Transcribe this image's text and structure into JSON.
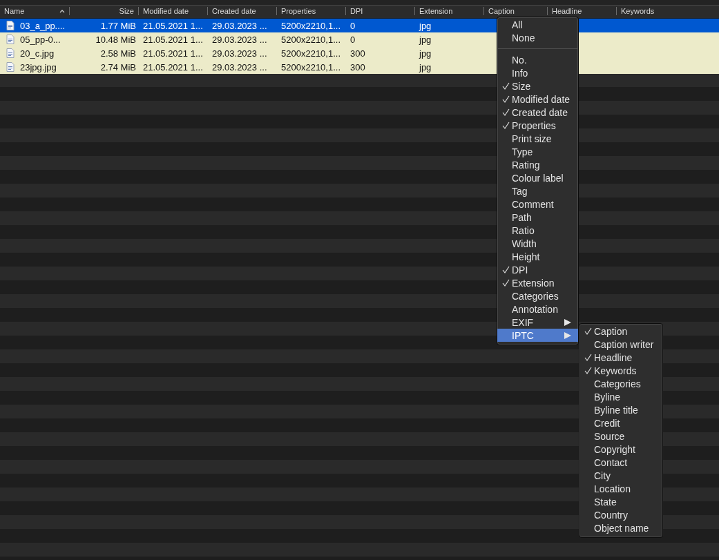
{
  "table": {
    "columns": [
      {
        "label": "Name",
        "sorted": true
      },
      {
        "label": "Size",
        "sorted": false
      },
      {
        "label": "Modified date",
        "sorted": false
      },
      {
        "label": "Created date",
        "sorted": false
      },
      {
        "label": "Properties",
        "sorted": false
      },
      {
        "label": "DPI",
        "sorted": false
      },
      {
        "label": "Extension",
        "sorted": false
      },
      {
        "label": "Caption",
        "sorted": false
      },
      {
        "label": "Headline",
        "sorted": false
      },
      {
        "label": "Keywords",
        "sorted": false
      }
    ],
    "rows": [
      {
        "selected": true,
        "cells": [
          "03_a_pp....",
          "1.77 MiB",
          "21.05.2021 1...",
          "29.03.2023 ...",
          "5200x2210,1...",
          "0",
          "jpg"
        ]
      },
      {
        "selected": false,
        "cells": [
          "05_pp-0...",
          "10.48 MiB",
          "21.05.2021 1...",
          "29.03.2023 ...",
          "5200x2210,1...",
          "0",
          "jpg"
        ]
      },
      {
        "selected": false,
        "cells": [
          "20_c.jpg",
          "2.58 MiB",
          "21.05.2021 1...",
          "29.03.2023 ...",
          "5200x2210,1...",
          "300",
          "jpg"
        ]
      },
      {
        "selected": false,
        "cells": [
          "23jpg.jpg",
          "2.74 MiB",
          "21.05.2021 1...",
          "29.03.2023 ...",
          "5200x2210,1...",
          "300",
          "jpg"
        ]
      }
    ]
  },
  "context_menu": {
    "items": [
      {
        "kind": "item",
        "label": "All",
        "checked": false
      },
      {
        "kind": "item",
        "label": "None",
        "checked": false
      },
      {
        "kind": "separator"
      },
      {
        "kind": "item",
        "label": "No.",
        "checked": false
      },
      {
        "kind": "item",
        "label": "Info",
        "checked": false
      },
      {
        "kind": "item",
        "label": "Size",
        "checked": true
      },
      {
        "kind": "item",
        "label": "Modified date",
        "checked": true
      },
      {
        "kind": "item",
        "label": "Created date",
        "checked": true
      },
      {
        "kind": "item",
        "label": "Properties",
        "checked": true
      },
      {
        "kind": "item",
        "label": "Print size",
        "checked": false
      },
      {
        "kind": "item",
        "label": "Type",
        "checked": false
      },
      {
        "kind": "item",
        "label": "Rating",
        "checked": false
      },
      {
        "kind": "item",
        "label": "Colour label",
        "checked": false
      },
      {
        "kind": "item",
        "label": "Tag",
        "checked": false
      },
      {
        "kind": "item",
        "label": "Comment",
        "checked": false
      },
      {
        "kind": "item",
        "label": "Path",
        "checked": false
      },
      {
        "kind": "item",
        "label": "Ratio",
        "checked": false
      },
      {
        "kind": "item",
        "label": "Width",
        "checked": false
      },
      {
        "kind": "item",
        "label": "Height",
        "checked": false
      },
      {
        "kind": "item",
        "label": "DPI",
        "checked": true
      },
      {
        "kind": "item",
        "label": "Extension",
        "checked": true
      },
      {
        "kind": "item",
        "label": "Categories",
        "checked": false
      },
      {
        "kind": "item",
        "label": "Annotation",
        "checked": false
      },
      {
        "kind": "submenu",
        "label": "EXIF",
        "selected": false
      },
      {
        "kind": "submenu",
        "label": "IPTC",
        "selected": true
      }
    ]
  },
  "submenu": {
    "items": [
      {
        "label": "Caption",
        "checked": true
      },
      {
        "label": "Caption writer",
        "checked": false
      },
      {
        "label": "Headline",
        "checked": true
      },
      {
        "label": "Keywords",
        "checked": true
      },
      {
        "label": "Categories",
        "checked": false
      },
      {
        "label": "Byline",
        "checked": false
      },
      {
        "label": "Byline title",
        "checked": false
      },
      {
        "label": "Credit",
        "checked": false
      },
      {
        "label": "Source",
        "checked": false
      },
      {
        "label": "Copyright",
        "checked": false
      },
      {
        "label": "Contact",
        "checked": false
      },
      {
        "label": "City",
        "checked": false
      },
      {
        "label": "Location",
        "checked": false
      },
      {
        "label": "State",
        "checked": false
      },
      {
        "label": "Country",
        "checked": false
      },
      {
        "label": "Object name",
        "checked": false
      }
    ]
  }
}
